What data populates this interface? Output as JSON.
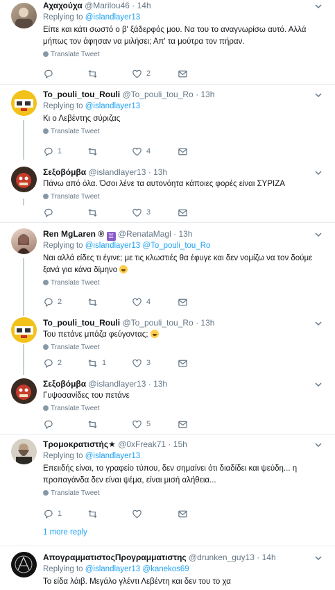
{
  "labels": {
    "replying": "Replying to",
    "translate": "Translate Tweet",
    "dot": "·"
  },
  "tweets": [
    {
      "name": "Αχαχούχα",
      "handle": "@Marilou46",
      "time": "14h",
      "reply_to": [
        "@islandlayer13"
      ],
      "text": "Είπε και κάτι σωστό ο β' ξάδερφός μου. Να του το αναγνωρίσω αυτό. Αλλά μήπως τον άφησαν να μιλήσει; Απ' τα μούτρα τον πήραν.",
      "replies": "",
      "retweets": "",
      "likes": "2"
    },
    {
      "name": "To_pouli_tou_Rouli",
      "handle": "@To_pouli_tou_Ro",
      "time": "13h",
      "reply_to": [
        "@islandlayer13"
      ],
      "text": "Κι ο Λεβέντης σύριζας",
      "replies": "1",
      "retweets": "",
      "likes": "4"
    },
    {
      "name": "Σεξοβόμβα",
      "handle": "@islandlayer13",
      "time": "13h",
      "reply_to": [],
      "text": "Πάνω από όλα. Όσοι λένε τα αυτονόητα κάποιες φορές είναι ΣΥΡΙΖΑ",
      "replies": "",
      "retweets": "",
      "likes": "3"
    },
    {
      "name": "Ren MgLaren ®",
      "badge": "♊",
      "handle": "@RenataMagl",
      "time": "13h",
      "reply_to": [
        "@islandlayer13",
        "@To_pouli_tou_Ro"
      ],
      "text": "Ναι αλλά είδες τι έγινε; με τις κλωστιές θα έφυγε και δεν νομίζω να τον δούμε ξανά για κάνα δίμηνο",
      "replies": "2",
      "retweets": "",
      "likes": "4"
    },
    {
      "name": "To_pouli_tou_Rouli",
      "handle": "@To_pouli_tou_Ro",
      "time": "13h",
      "reply_to": [],
      "text": "Του πετάνε μπάζα φεύγοντας;",
      "replies": "2",
      "retweets": "1",
      "likes": "3"
    },
    {
      "name": "Σεξοβόμβα",
      "handle": "@islandlayer13",
      "time": "13h",
      "reply_to": [],
      "text": "Γυψοσανίδες του πετάνε",
      "replies": "",
      "retweets": "",
      "likes": "5"
    },
    {
      "name": "Τρομοκρατιστής★",
      "handle": "@0xFreak71",
      "time": "15h",
      "reply_to": [
        "@islandlayer13"
      ],
      "text": "Επειιδής είναι, το γραφείο τύπου, δεν σημαίνει ότι διαδίδει και ψεύδη... η προπαγάνδα δεν είναι ψέμα, είναι μισή αλήθεια...",
      "replies": "1",
      "retweets": "",
      "likes": ""
    },
    {
      "name": "ΑπογραμματιστοςΠρογραμματιστης",
      "handle": "@drunken_guy13",
      "time": "14h",
      "reply_to": [
        "@islandlayer13",
        "@kanekos69"
      ],
      "text": "Το είδα λάιβ. Μεγάλο γλέντι Λεβέντη και δεν του το χα",
      "replies": "",
      "retweets": "",
      "likes": ""
    }
  ],
  "more_reply": "1 more reply",
  "colors": {
    "link": "#1da1f2",
    "muted": "#657786",
    "thread": "#c4cfd6",
    "divider": "#e6ecf0"
  }
}
